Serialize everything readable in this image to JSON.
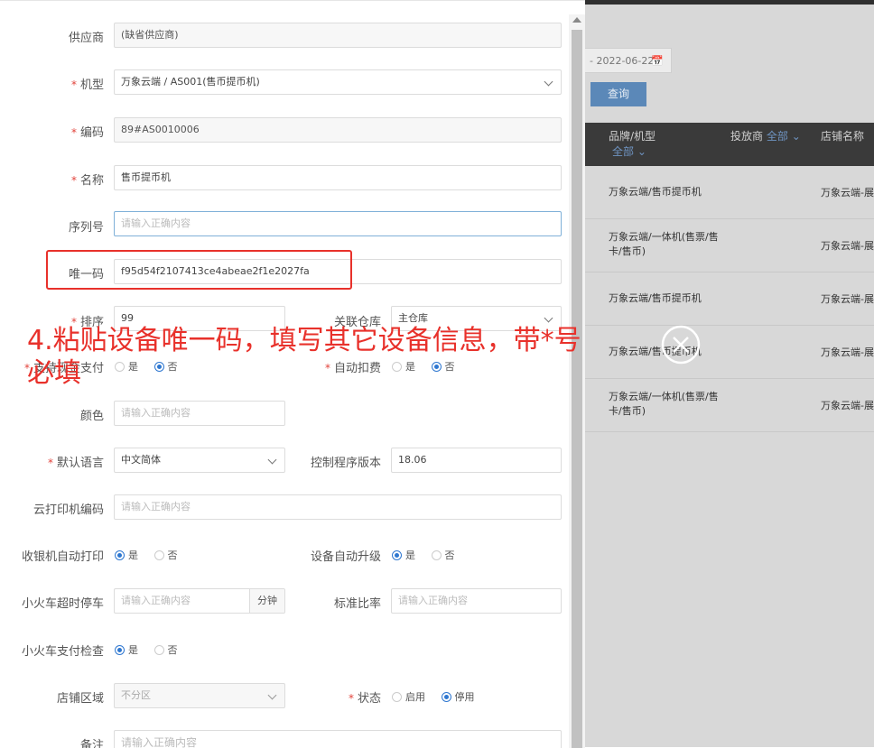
{
  "form": {
    "supplier": {
      "label": "供应商",
      "value": "(缺省供应商)"
    },
    "model": {
      "label": "机型",
      "value": "万象云端 / AS001(售币提币机)"
    },
    "code": {
      "label": "编码",
      "value": "89#AS0010006"
    },
    "name": {
      "label": "名称",
      "value": "售币提币机"
    },
    "serial": {
      "label": "序列号",
      "placeholder": "请输入正确内容"
    },
    "uid": {
      "label": "唯一码",
      "value": "f95d54f2107413ce4abeae2f1e2027fa"
    },
    "sort": {
      "label": "排序",
      "value": "99"
    },
    "warehouse": {
      "label": "关联仓库",
      "value": "主仓库"
    },
    "cash_pay": {
      "label": "支持现金支付",
      "options": [
        "是",
        "否"
      ],
      "selected": "否"
    },
    "auto_deduct": {
      "label": "自动扣费",
      "options": [
        "是",
        "否"
      ],
      "selected": "否"
    },
    "color": {
      "label": "颜色",
      "placeholder": "请输入正确内容"
    },
    "language": {
      "label": "默认语言",
      "value": "中文简体"
    },
    "ctrl_version": {
      "label": "控制程序版本",
      "value": "18.06"
    },
    "cloud_printer": {
      "label": "云打印机编码",
      "placeholder": "请输入正确内容"
    },
    "cashier_print": {
      "label": "收银机自动打印",
      "options": [
        "是",
        "否"
      ],
      "selected": "是"
    },
    "auto_upgrade": {
      "label": "设备自动升级",
      "options": [
        "是",
        "否"
      ],
      "selected": "是"
    },
    "train_timeout": {
      "label": "小火车超时停车",
      "placeholder": "请输入正确内容",
      "unit": "分钟"
    },
    "std_ratio": {
      "label": "标准比率",
      "placeholder": "请输入正确内容"
    },
    "train_pay_check": {
      "label": "小火车支付检查",
      "options": [
        "是",
        "否"
      ],
      "selected": "是"
    },
    "area": {
      "label": "店铺区域",
      "value": "不分区"
    },
    "status": {
      "label": "状态",
      "options": [
        "启用",
        "停用"
      ],
      "selected": "停用"
    },
    "remark": {
      "label": "备注",
      "placeholder": "请输入正确内容"
    },
    "required_mark": "*"
  },
  "annotation": "4.粘贴设备唯一码，填写其它设备信息，带*号必填",
  "background": {
    "date_end": "- 2022-06-22",
    "query_button": "查询",
    "columns": {
      "brand_model": "品牌/机型",
      "all1": "全部",
      "operator": "投放商",
      "all2": "全部",
      "store": "店铺名称"
    },
    "rows": [
      {
        "model": "万象云端/售币提币机",
        "store": "万象云端-展"
      },
      {
        "model": "万象云端/一体机(售票/售卡/售币)",
        "store": "万象云端-展"
      },
      {
        "model": "万象云端/售币提币机",
        "store": "万象云端-展"
      },
      {
        "model": "万象云端/售币提币机",
        "store": "万象云端-展"
      },
      {
        "model": "万象云端/一体机(售票/售卡/售币)",
        "store": "万象云端-展"
      }
    ]
  },
  "colors": {
    "accent": "#2e77d0",
    "required": "#e2433b",
    "annotation": "#e8312b",
    "overlay": "#d8d8d8"
  }
}
